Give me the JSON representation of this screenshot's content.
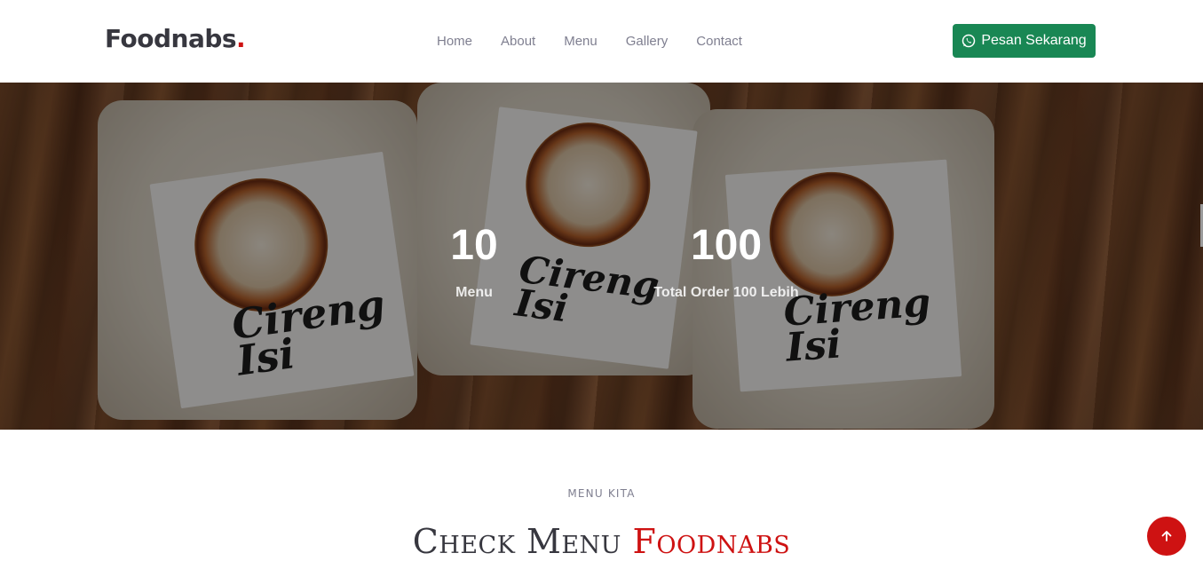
{
  "header": {
    "logo": "Foodnabs",
    "logo_dot": ".",
    "nav": [
      "Home",
      "About",
      "Menu",
      "Gallery",
      "Contact"
    ],
    "cta_label": "Pesan Sekarang",
    "cta_icon": "whatsapp-icon"
  },
  "hero": {
    "stats": [
      {
        "number": "10",
        "label": "Menu"
      },
      {
        "number": "100",
        "label": "Total Order 100 Lebih"
      }
    ]
  },
  "menu_section": {
    "subtitle": "MENU KITA",
    "title_main": "Check Menu",
    "title_accent": "Foodnabs"
  },
  "scroll_top_icon": "arrow-up-icon",
  "colors": {
    "accent": "#ce1212",
    "whatsapp_green": "#198754",
    "text_dark": "#37373f",
    "text_muted": "#7f7f90"
  }
}
